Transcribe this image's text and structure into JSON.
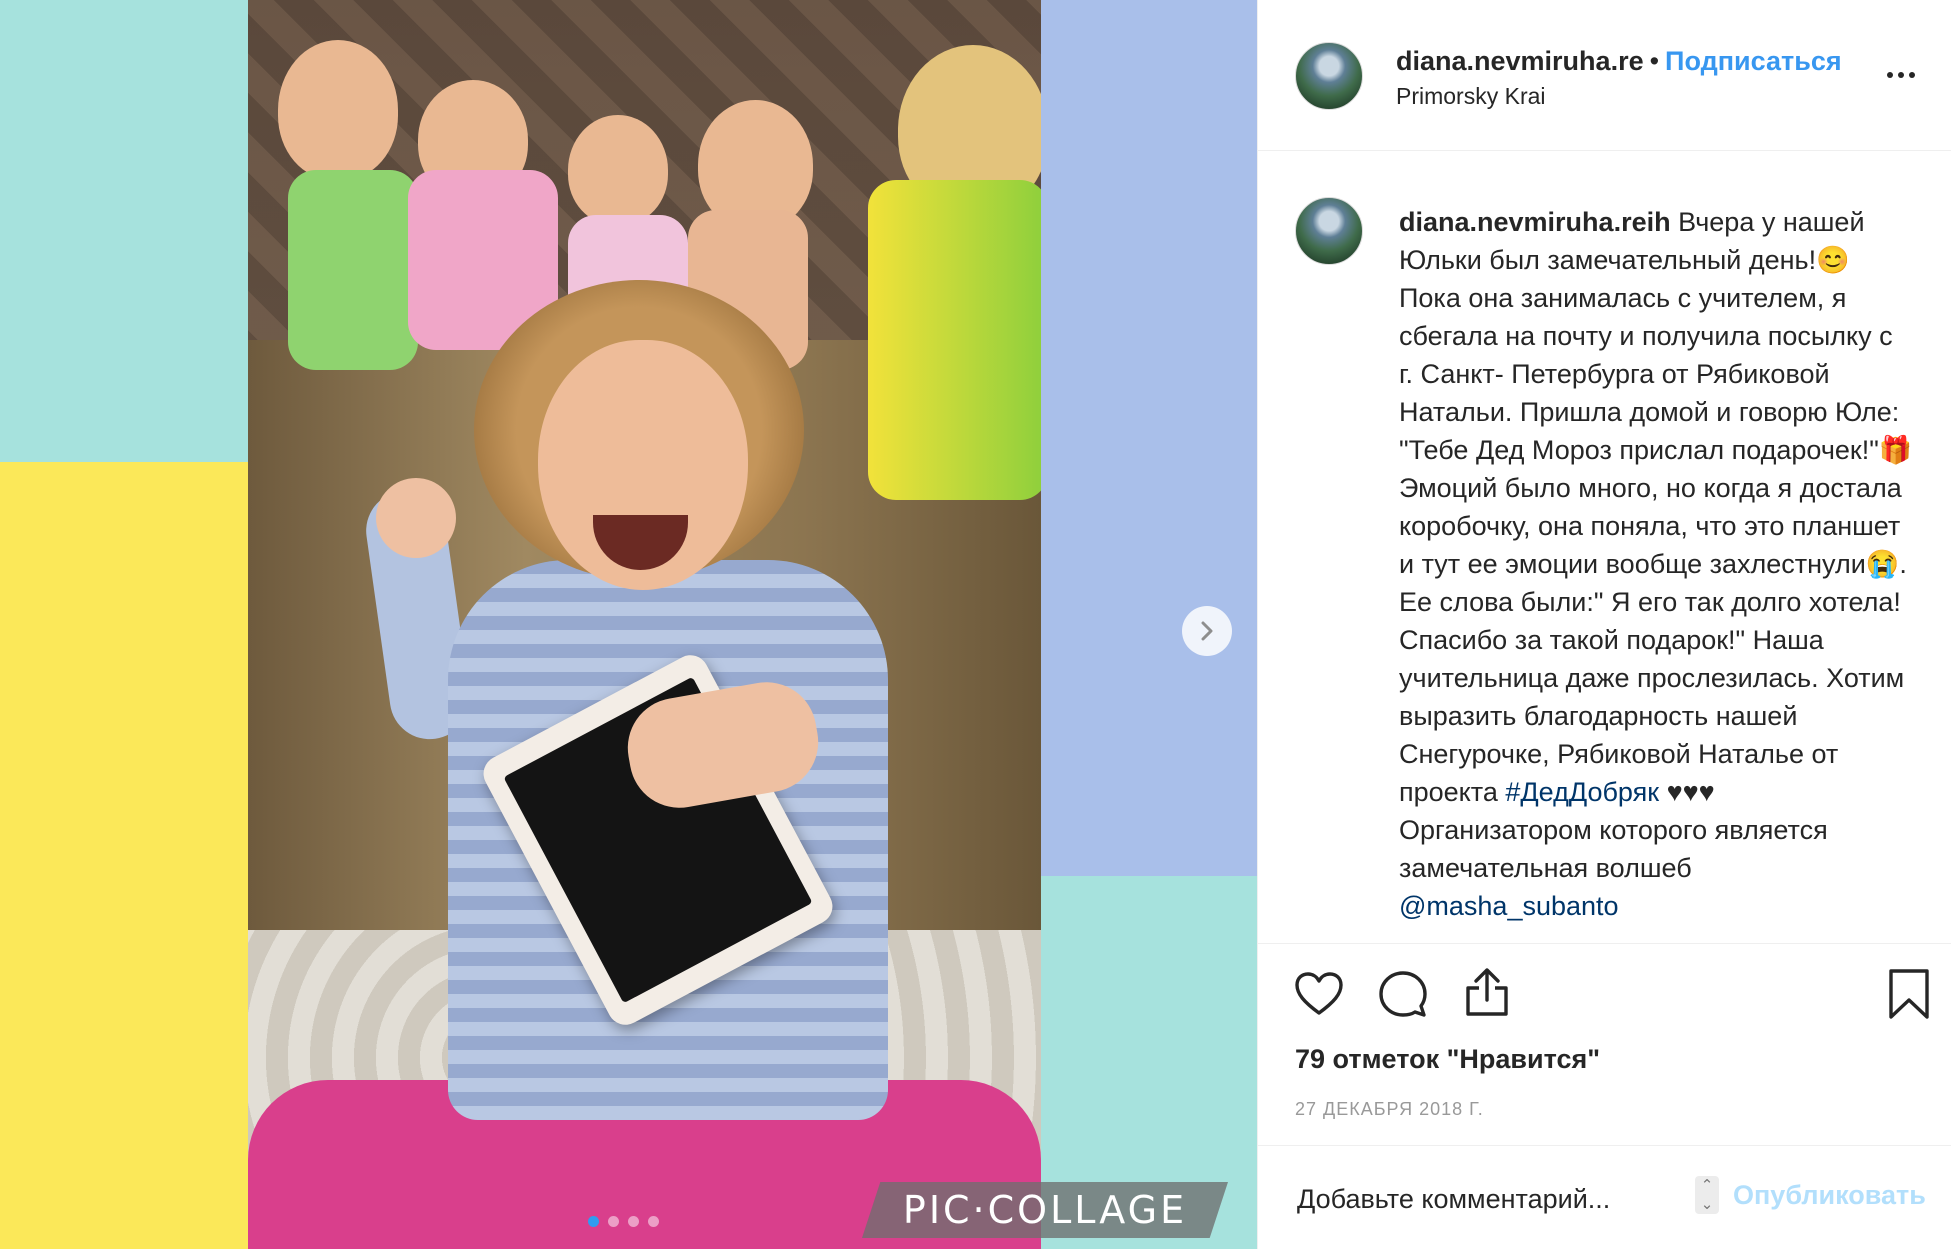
{
  "colors": {
    "bg_teal": "#a6e2dd",
    "bg_yellow": "#fbe859",
    "bg_blue": "#a9bfea",
    "follow_blue": "#3897f0",
    "hashtag_blue": "#003569",
    "date_grey": "#999999"
  },
  "media": {
    "watermark": "PIC·COLLAGE",
    "next_icon": "chevron-right-icon",
    "carousel": {
      "count": 4,
      "active_index": 0
    }
  },
  "header": {
    "username": "diana.nevmiruha.re",
    "bullet": "•",
    "follow_label": "Подписаться",
    "location": "Primorsky Krai",
    "more_icon": "more-dots-icon"
  },
  "caption": {
    "username": "diana.nevmiruha.reih",
    "text_1": "Вчера у нашей Юльки был замечательный день!😊 Пока она занималась с учителем, я сбегала на почту и получила посылку с г. Санкт- Петербурга от Рябиковой Натальи. Пришла домой и говорю Юле: \"Тебе Дед Мороз прислал подарочек!\"🎁 Эмоций было много, но когда я достала коробочку, она поняла, что это планшет и тут ее эмоции вообще захлестнули😭. Ее слова были:\" Я его так долго хотела! Спасибо за такой подарок!\" Наша учительница даже прослезилась. Хотим выразить благодарность нашей Снегурочке, Рябиковой Наталье от проекта ",
    "hashtag": "#ДедДобряк",
    "text_2": " ♥♥♥ Организатором которого является замечательная волшеб ",
    "mention": "@masha_subanto"
  },
  "actions": {
    "like_icon": "heart-icon",
    "comment_icon": "comment-icon",
    "share_icon": "share-icon",
    "save_icon": "bookmark-icon"
  },
  "likes_text": "79 отметок \"Нравится\"",
  "date_text": "27 ДЕКАБРЯ 2018 Г.",
  "comment_box": {
    "placeholder": "Добавьте комментарий...",
    "post_label": "Опубликовать"
  }
}
